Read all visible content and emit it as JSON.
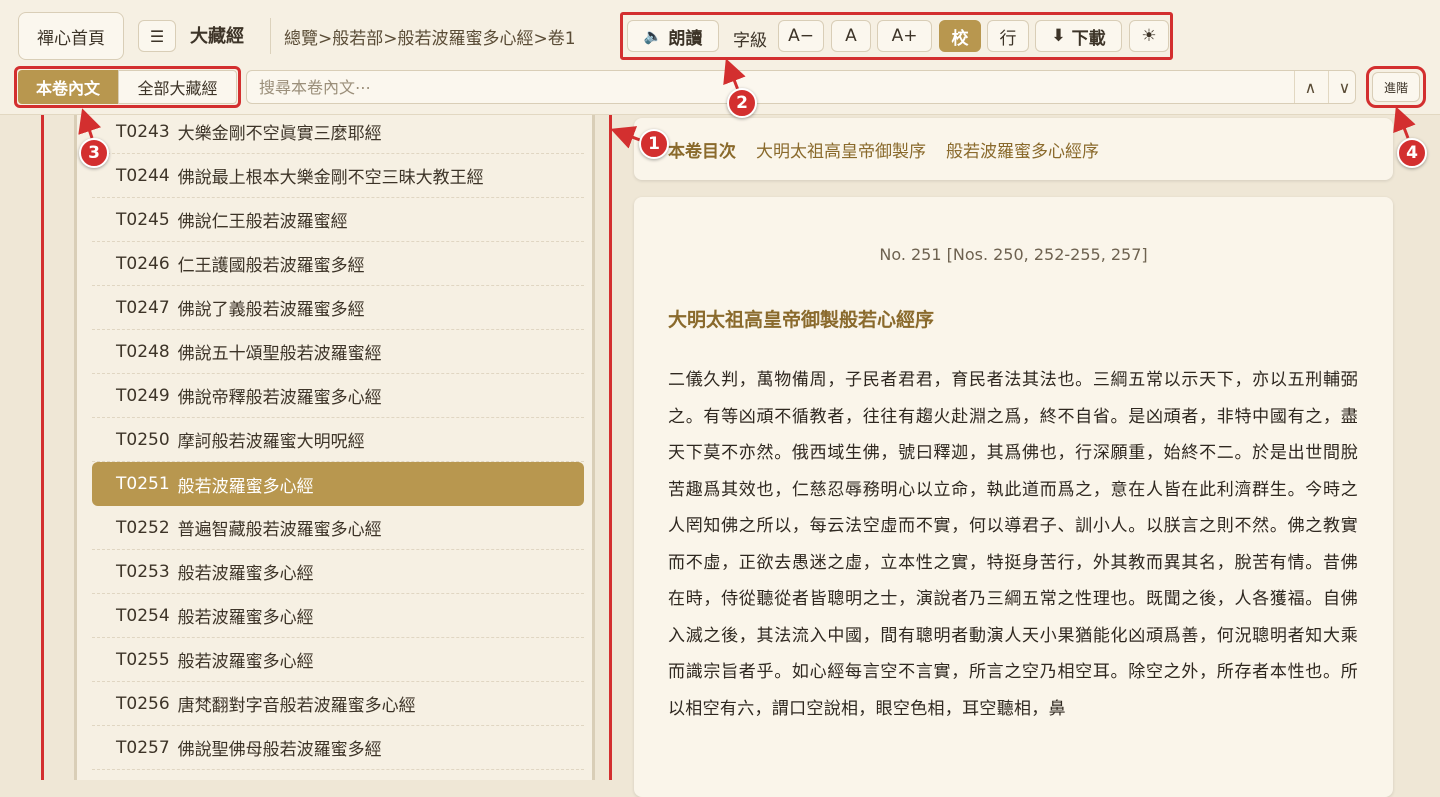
{
  "header": {
    "home_label": "禪心首頁",
    "menu_icon": "☰",
    "app_title": "大藏經",
    "breadcrumb": "總覽>般若部>般若波羅蜜多心經>卷1"
  },
  "toolbar": {
    "read_icon": "🔈",
    "read_label": "朗讀",
    "font_label": "字級",
    "font_smaller": "A−",
    "font_normal": "A",
    "font_larger": "A+",
    "collate_label": "校",
    "line_label": "行",
    "download_icon": "⬇",
    "download_label": "下載",
    "theme_icon": "☀"
  },
  "search": {
    "scope_current": "本卷內文",
    "scope_all": "全部大藏經",
    "placeholder": "搜尋本卷內文⋯",
    "prev": "∧",
    "next": "∨",
    "advanced": "進階"
  },
  "sutra_list": [
    {
      "code": "T0243",
      "title": "大樂金剛不空眞實三麼耶經"
    },
    {
      "code": "T0244",
      "title": "佛說最上根本大樂金剛不空三昧大教王經"
    },
    {
      "code": "T0245",
      "title": "佛說仁王般若波羅蜜經"
    },
    {
      "code": "T0246",
      "title": "仁王護國般若波羅蜜多經"
    },
    {
      "code": "T0247",
      "title": "佛說了義般若波羅蜜多經"
    },
    {
      "code": "T0248",
      "title": "佛說五十頌聖般若波羅蜜經"
    },
    {
      "code": "T0249",
      "title": "佛說帝釋般若波羅蜜多心經"
    },
    {
      "code": "T0250",
      "title": "摩訶般若波羅蜜大明呪經"
    },
    {
      "code": "T0251",
      "title": "般若波羅蜜多心經"
    },
    {
      "code": "T0252",
      "title": "普遍智藏般若波羅蜜多心經"
    },
    {
      "code": "T0253",
      "title": "般若波羅蜜多心經"
    },
    {
      "code": "T0254",
      "title": "般若波羅蜜多心經"
    },
    {
      "code": "T0255",
      "title": "般若波羅蜜多心經"
    },
    {
      "code": "T0256",
      "title": "唐梵翻對字音般若波羅蜜多心經"
    },
    {
      "code": "T0257",
      "title": "佛說聖佛母般若波羅蜜多經"
    }
  ],
  "selected_code": "T0251",
  "toc": {
    "label": "本卷目次",
    "items": [
      "大明太祖高皇帝御製序",
      "般若波羅蜜多心經序"
    ]
  },
  "document": {
    "number_line": "No. 251 [Nos. 250, 252-255, 257]",
    "title": "大明太祖高皇帝御製般若心經序",
    "paragraph": "二儀久判，萬物備周，子民者君君，育民者法其法也。三綱五常以示天下，亦以五刑輔弼之。有等凶頑不循教者，往往有趨火赴淵之爲，終不自省。是凶頑者，非特中國有之，盡天下莫不亦然。俄西域生佛，號曰釋迦，其爲佛也，行深願重，始終不二。於是出世間脫苦趣爲其效也，仁慈忍辱務明心以立命，執此道而爲之，意在人皆在此利濟群生。今時之人罔知佛之所以，每云法空虛而不實，何以導君子、訓小人。以朕言之則不然。佛之教實而不虛，正欲去愚迷之虛，立本性之實，特挺身苦行，外其教而異其名，脫苦有情。昔佛在時，侍從聽從者皆聰明之士，演說者乃三綱五常之性理也。既聞之後，人各獲福。自佛入滅之後，其法流入中國，間有聰明者動演人天小果猶能化凶頑爲善，何況聰明者知大乘而識宗旨者乎。如心經每言空不言實，所言之空乃相空耳。除空之外，所存者本性也。所以相空有六，謂口空說相，眼空色相，耳空聽相，鼻"
  },
  "annotations": [
    "1",
    "2",
    "3",
    "4"
  ],
  "colors": {
    "accent": "#b8974f",
    "annotation": "#d32f2f",
    "background": "#efe7d6",
    "panel": "#f6f0e3"
  }
}
